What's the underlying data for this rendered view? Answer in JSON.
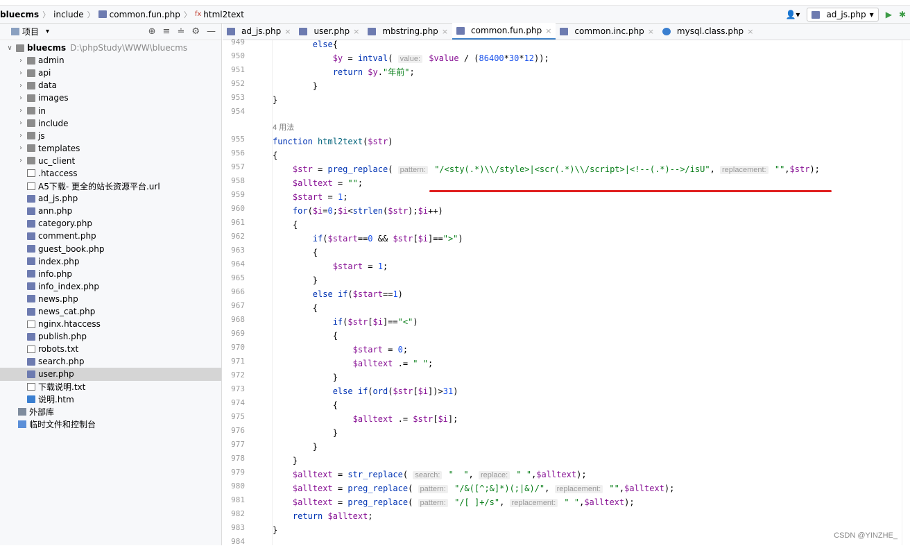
{
  "breadcrumb": {
    "project": "bluecms",
    "dir": "include",
    "file": "common.fun.php",
    "function": "html2text"
  },
  "runconfig": {
    "label": "ad_js.php",
    "user_icon": "user-icon"
  },
  "sidebar": {
    "title": "项目",
    "root": "bluecms",
    "root_path": "D:\\phpStudy\\WWW\\bluecms",
    "items": [
      {
        "label": "admin",
        "type": "folder"
      },
      {
        "label": "api",
        "type": "folder"
      },
      {
        "label": "data",
        "type": "folder"
      },
      {
        "label": "images",
        "type": "folder"
      },
      {
        "label": "in",
        "type": "folder"
      },
      {
        "label": "include",
        "type": "folder"
      },
      {
        "label": "js",
        "type": "folder"
      },
      {
        "label": "templates",
        "type": "folder"
      },
      {
        "label": "uc_client",
        "type": "folder"
      },
      {
        "label": ".htaccess",
        "type": "txt"
      },
      {
        "label": "A5下载- 更全的站长资源平台.url",
        "type": "txt"
      },
      {
        "label": "ad_js.php",
        "type": "php"
      },
      {
        "label": "ann.php",
        "type": "php"
      },
      {
        "label": "category.php",
        "type": "php"
      },
      {
        "label": "comment.php",
        "type": "php"
      },
      {
        "label": "guest_book.php",
        "type": "php"
      },
      {
        "label": "index.php",
        "type": "php"
      },
      {
        "label": "info.php",
        "type": "php"
      },
      {
        "label": "info_index.php",
        "type": "php"
      },
      {
        "label": "news.php",
        "type": "php"
      },
      {
        "label": "news_cat.php",
        "type": "php"
      },
      {
        "label": "nginx.htaccess",
        "type": "txt"
      },
      {
        "label": "publish.php",
        "type": "php"
      },
      {
        "label": "robots.txt",
        "type": "txt"
      },
      {
        "label": "search.php",
        "type": "php"
      },
      {
        "label": "user.php",
        "type": "php"
      },
      {
        "label": "下载说明.txt",
        "type": "txt"
      },
      {
        "label": "说明.htm",
        "type": "htm"
      }
    ],
    "external": "外部库",
    "scratches": "临时文件和控制台"
  },
  "tabs": [
    {
      "label": "ad_js.php"
    },
    {
      "label": "user.php"
    },
    {
      "label": "mbstring.php"
    },
    {
      "label": "common.fun.php"
    },
    {
      "label": "common.inc.php"
    },
    {
      "label": "mysql.class.php"
    }
  ],
  "code": {
    "usages": "4 用法",
    "lines": [
      {
        "n": "949",
        "t": "        else{"
      },
      {
        "n": "950",
        "t": "            $y = intval( value: $value / (86400*30*12));"
      },
      {
        "n": "951",
        "t": "            return $y.\"年前\";"
      },
      {
        "n": "952",
        "t": "        }"
      },
      {
        "n": "953",
        "t": "}"
      },
      {
        "n": "954",
        "t": ""
      },
      {
        "n": "955",
        "t": "function html2text($str)"
      },
      {
        "n": "956",
        "t": "{"
      },
      {
        "n": "957",
        "t": "    $str = preg_replace( pattern: \"/<sty(.*)\\\\/style>|<scr(.*)\\\\/script>|<!--(.*)-->/isU\", replacement: \"\",$str);"
      },
      {
        "n": "958",
        "t": "    $alltext = \"\";"
      },
      {
        "n": "959",
        "t": "    $start = 1;"
      },
      {
        "n": "960",
        "t": "    for($i=0;$i<strlen($str);$i++)"
      },
      {
        "n": "961",
        "t": "    {"
      },
      {
        "n": "962",
        "t": "        if($start==0 && $str[$i]==\">\")"
      },
      {
        "n": "963",
        "t": "        {"
      },
      {
        "n": "964",
        "t": "            $start = 1;"
      },
      {
        "n": "965",
        "t": "        }"
      },
      {
        "n": "966",
        "t": "        else if($start==1)"
      },
      {
        "n": "967",
        "t": "        {"
      },
      {
        "n": "968",
        "t": "            if($str[$i]==\"<\")"
      },
      {
        "n": "969",
        "t": "            {"
      },
      {
        "n": "970",
        "t": "                $start = 0;"
      },
      {
        "n": "971",
        "t": "                $alltext .= \" \";"
      },
      {
        "n": "972",
        "t": "            }"
      },
      {
        "n": "973",
        "t": "            else if(ord($str[$i])>31)"
      },
      {
        "n": "974",
        "t": "            {"
      },
      {
        "n": "975",
        "t": "                $alltext .= $str[$i];"
      },
      {
        "n": "976",
        "t": "            }"
      },
      {
        "n": "977",
        "t": "        }"
      },
      {
        "n": "978",
        "t": "    }"
      },
      {
        "n": "979",
        "t": "    $alltext = str_replace( search: \"  \", replace: \" \",$alltext);"
      },
      {
        "n": "980",
        "t": "    $alltext = preg_replace( pattern: \"/&([^;&]*)(;|&)/\", replacement: \"\",$alltext);"
      },
      {
        "n": "981",
        "t": "    $alltext = preg_replace( pattern: \"/[ ]+/s\", replacement: \" \",$alltext);"
      },
      {
        "n": "982",
        "t": "    return $alltext;"
      },
      {
        "n": "983",
        "t": "}"
      },
      {
        "n": "984",
        "t": ""
      }
    ]
  },
  "watermark": "CSDN @YINZHE_"
}
